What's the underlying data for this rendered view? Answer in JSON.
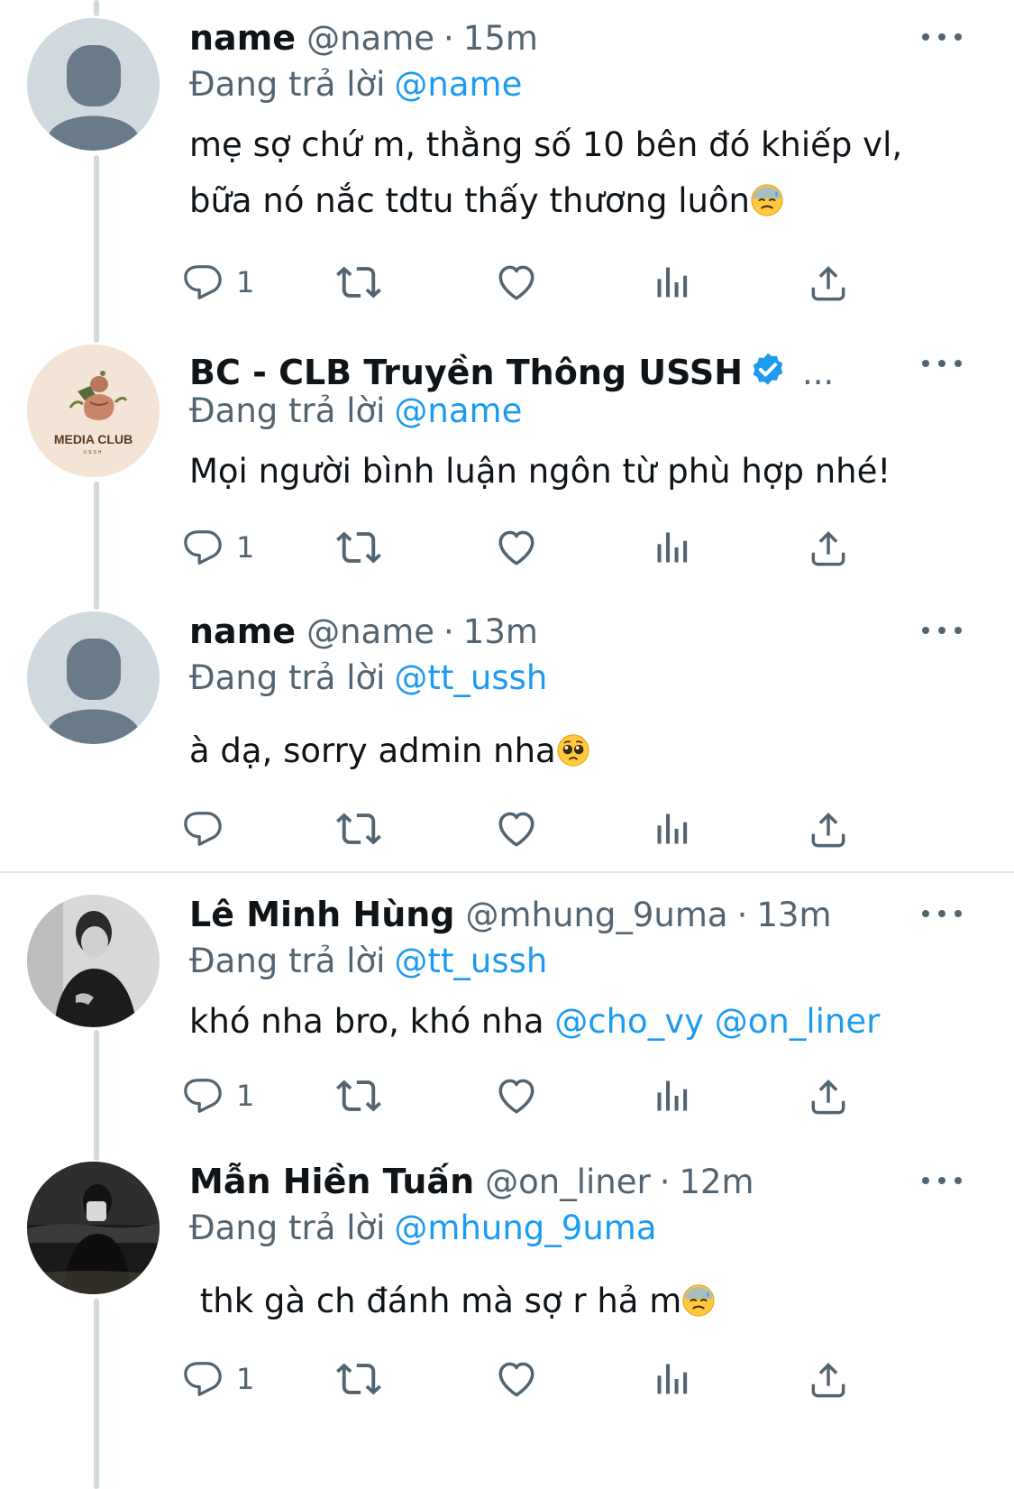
{
  "colors": {
    "text": "#0f1419",
    "secondary": "#536471",
    "link": "#1d9bf0",
    "line": "#cfd9de"
  },
  "tweets": [
    {
      "display_name": "name",
      "handle": "@name",
      "separator": "·",
      "time": "15m",
      "replying_label": "Đang trả lời",
      "replying_to": "@name",
      "text_lines": [
        "mẹ sợ chứ m, thằng số 10 bên đó khiếp vl,",
        "bữa nó nắc tdtu thấy thương luôn"
      ],
      "emoji": "downcast-sweat-face",
      "reply_count": "1",
      "avatar": "default-avatar-icon"
    },
    {
      "display_name": "BC - CLB Truyền Thông USSH",
      "verified": true,
      "truncation": "...",
      "replying_label": "Đang trả lời",
      "replying_to": "@name",
      "text_lines": [
        "Mọi người bình luận ngôn từ phù hợp nhé!"
      ],
      "reply_count": "1",
      "avatar": "media-club-logo",
      "avatar_text": "MEDIA CLUB",
      "avatar_subtext": "USSH"
    },
    {
      "display_name": "name",
      "handle": "@name",
      "separator": "·",
      "time": "13m",
      "replying_label": "Đang trả lời",
      "replying_to": "@tt_ussh",
      "text_lines": [
        "à dạ, sorry admin nha"
      ],
      "emoji": "pleading-face",
      "reply_count": "",
      "avatar": "default-avatar-icon"
    },
    {
      "display_name": "Lê Minh Hùng",
      "handle": "@mhung_9uma",
      "separator": "·",
      "time": "13m",
      "replying_label": "Đang trả lời",
      "replying_to": "@tt_ussh",
      "text_lines": [
        "khó nha bro, khó nha "
      ],
      "mentions": [
        "@cho_vy",
        "@on_liner"
      ],
      "reply_count": "1",
      "avatar": "profile-photo"
    },
    {
      "display_name": "Mẫn Hiền Tuấn",
      "handle": "@on_liner",
      "separator": "·",
      "time": "12m",
      "replying_label": "Đang trả lời",
      "replying_to": "@mhung_9uma",
      "text_lines": [
        " thk gà ch đánh mà sợ r hả m"
      ],
      "emoji": "downcast-sweat-face",
      "reply_count": "1",
      "avatar": "profile-photo"
    }
  ]
}
